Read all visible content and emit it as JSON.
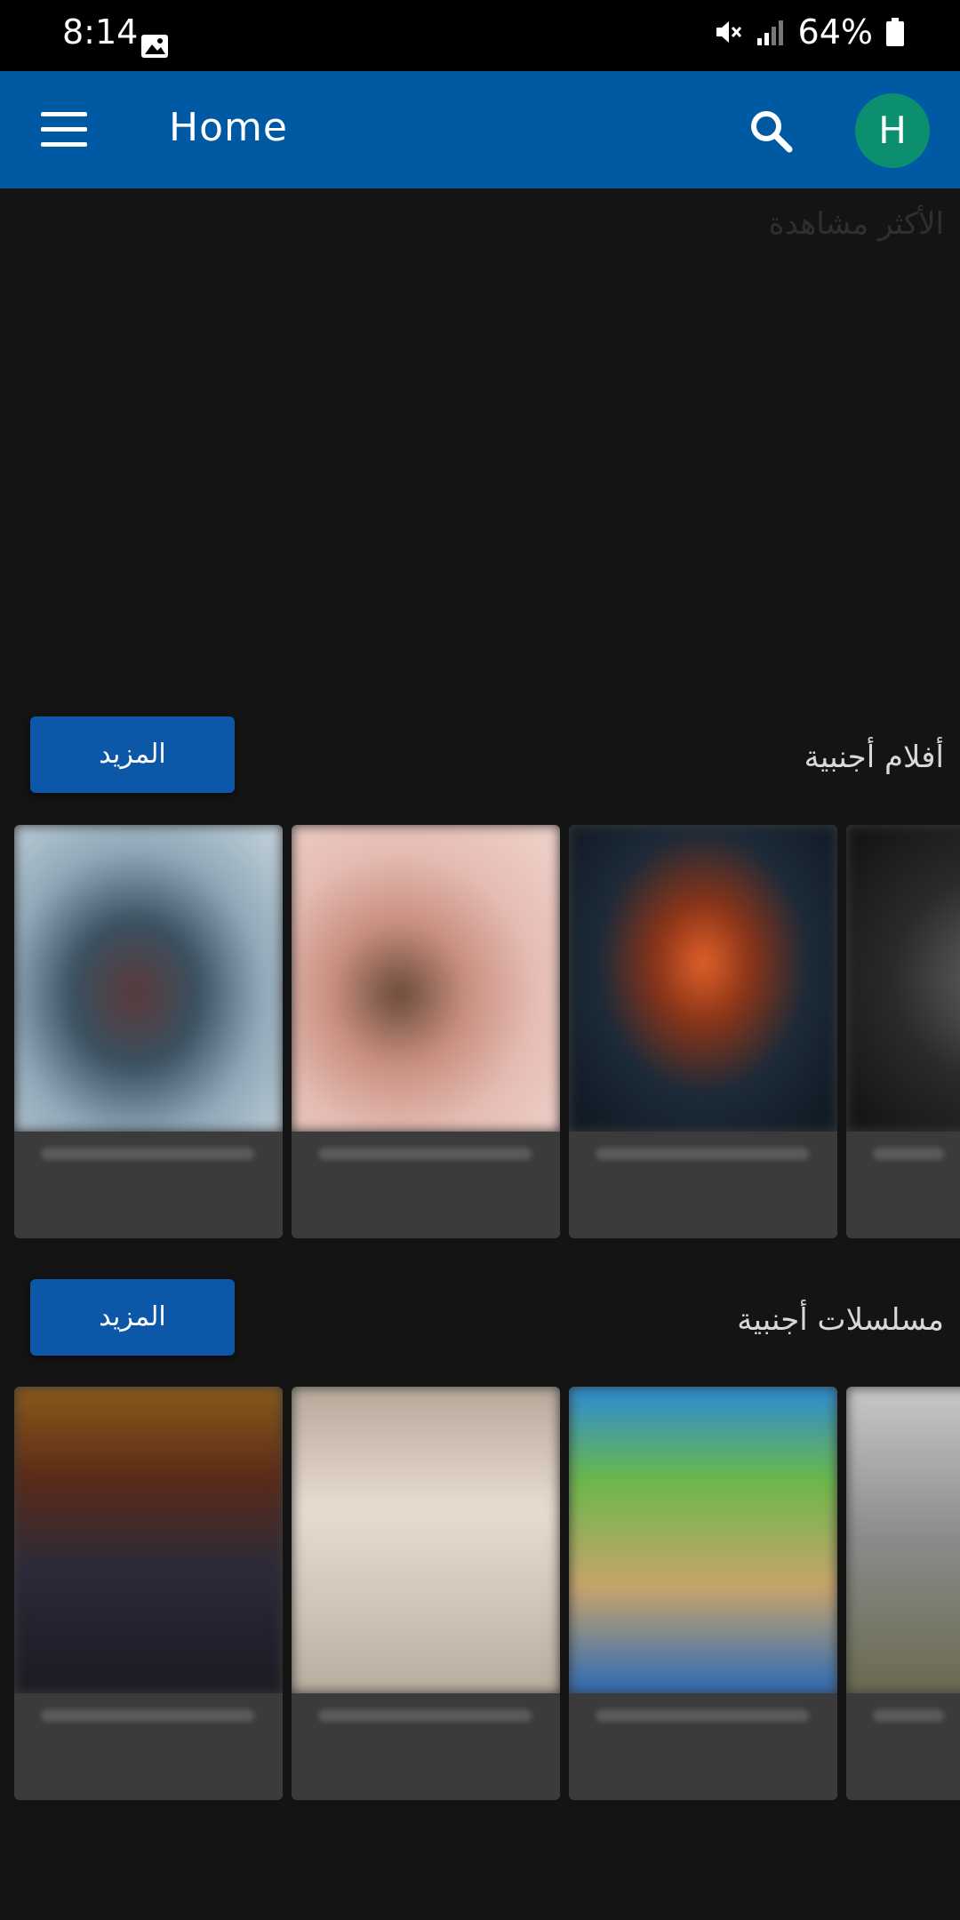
{
  "status_bar": {
    "time": "8:14",
    "battery": "64%"
  },
  "app_bar": {
    "title": "Home",
    "avatar_letter": "H"
  },
  "sections": {
    "most_viewed": {
      "title": "الأكثر مشاهدة"
    },
    "foreign_movies": {
      "title": "أفلام أجنبية",
      "more_label": "المزيد"
    },
    "foreign_series": {
      "title": "مسلسلات أجنبية",
      "more_label": "المزيد"
    }
  },
  "colors": {
    "app_bar": "#0059a3",
    "background": "#141414",
    "button": "#0c57a8",
    "avatar": "#0c8f6f"
  }
}
